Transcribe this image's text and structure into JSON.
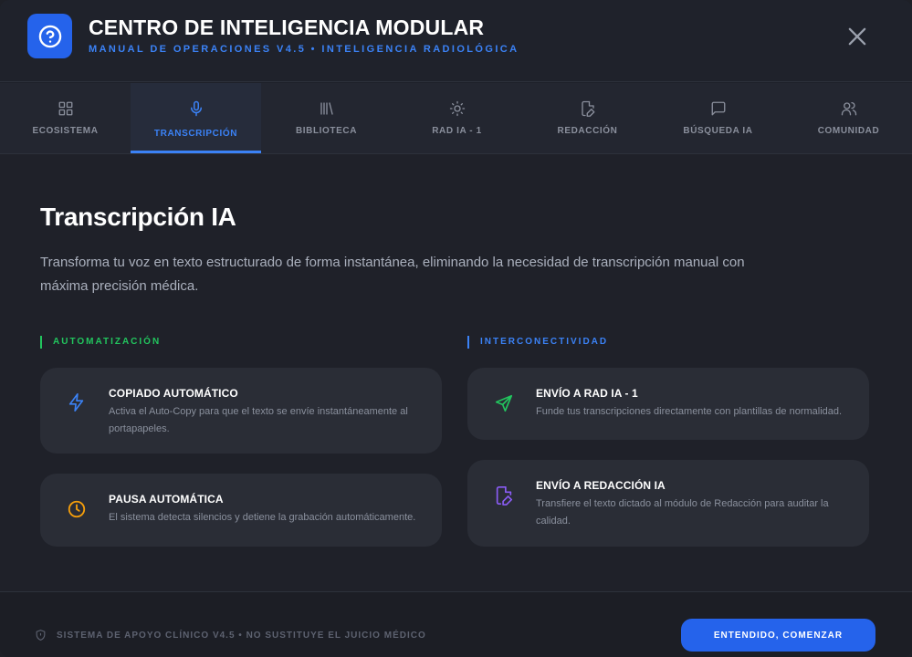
{
  "header": {
    "title": "CENTRO DE INTELIGENCIA MODULAR",
    "subtitle": "MANUAL DE OPERACIONES V4.5 • INTELIGENCIA RADIOLÓGICA",
    "icon": "help-circle-icon",
    "close_icon": "close-icon"
  },
  "tabs": [
    {
      "label": "ECOSISTEMA",
      "icon": "grid-icon"
    },
    {
      "label": "TRANSCRIPCIÓN",
      "icon": "microphone-icon",
      "active": true
    },
    {
      "label": "BIBLIOTECA",
      "icon": "library-icon"
    },
    {
      "label": "RAD IA - 1",
      "icon": "sun-icon"
    },
    {
      "label": "REDACCIÓN",
      "icon": "file-edit-icon"
    },
    {
      "label": "BÚSQUEDA IA",
      "icon": "message-square-icon"
    },
    {
      "label": "COMUNIDAD",
      "icon": "users-icon"
    }
  ],
  "main": {
    "title": "Transcripción IA",
    "description": "Transforma tu voz en texto estructurado de forma instantánea, eliminando la necesidad de transcripción manual con máxima precisión médica.",
    "sections": {
      "automatizacion": {
        "label": "AUTOMATIZACIÓN",
        "cards": [
          {
            "title": "COPIADO AUTOMÁTICO",
            "description": "Activa el Auto-Copy para que el texto se envíe instantáneamente al portapapeles.",
            "icon": "zap-icon"
          },
          {
            "title": "PAUSA AUTOMÁTICA",
            "description": "El sistema detecta silencios y detiene la grabación automáticamente.",
            "icon": "clock-icon"
          }
        ]
      },
      "interconectividad": {
        "label": "INTERCONECTIVIDAD",
        "cards": [
          {
            "title": "ENVÍO A RAD IA - 1",
            "description": "Funde tus transcripciones directamente con plantillas de normalidad.",
            "icon": "send-icon"
          },
          {
            "title": "ENVÍO A REDACCIÓN IA",
            "description": "Transfiere el texto dictado al módulo de Redacción para auditar la calidad.",
            "icon": "file-edit-icon"
          }
        ]
      }
    }
  },
  "footer": {
    "note": "SISTEMA DE APOYO CLÍNICO V4.5 • NO SUSTITUYE EL JUICIO MÉDICO",
    "note_icon": "shield-icon",
    "cta_label": "ENTENDIDO, COMENZAR"
  },
  "colors": {
    "accent": "#2563eb",
    "accent_text": "#3b82f6",
    "automation": "#22c55e",
    "warning": "#f59e0b",
    "purple": "#8b5cf6"
  }
}
